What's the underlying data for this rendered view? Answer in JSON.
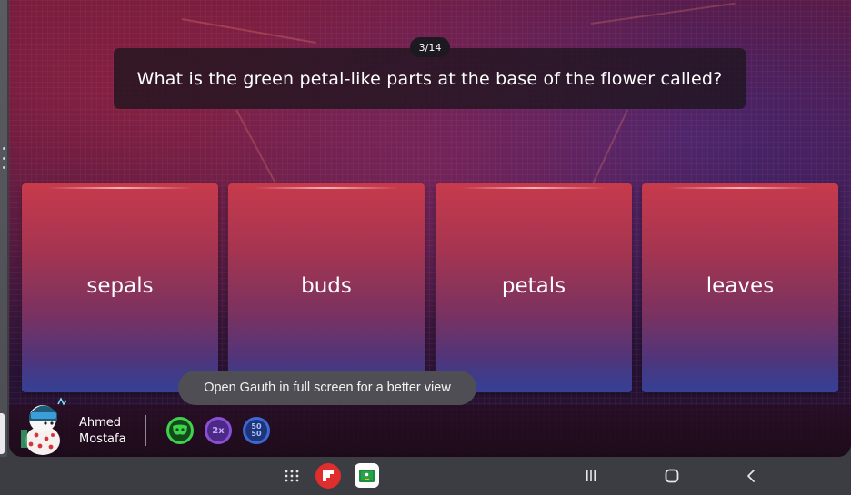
{
  "quiz": {
    "counter": "3/14",
    "question": "What is the green petal-like parts at the base of the flower called?",
    "answers": [
      "sepals",
      "buds",
      "petals",
      "leaves"
    ]
  },
  "toast": {
    "text": "Open Gauth in full screen for a better view"
  },
  "player": {
    "first_name": "Ahmed",
    "last_name": "Mostafa"
  },
  "powerups": [
    {
      "name": "mask-powerup",
      "label": "",
      "color": "#3fd24a"
    },
    {
      "name": "double-points-powerup",
      "label": "2x",
      "color": "#8a4fd6"
    },
    {
      "name": "fifty-fifty-powerup",
      "label_top": "50",
      "label_bottom": "50",
      "color": "#3d68d8"
    }
  ],
  "nav": {
    "icons": [
      "app-drawer-icon",
      "flipboard-app-icon",
      "google-classroom-app-icon",
      "recents-icon",
      "home-icon",
      "back-icon"
    ]
  },
  "colors": {
    "answer_top": "#c73a4c",
    "answer_bottom": "#38397d",
    "toast_bg": "#4e4e54",
    "nav_bg": "#3b3d42"
  }
}
